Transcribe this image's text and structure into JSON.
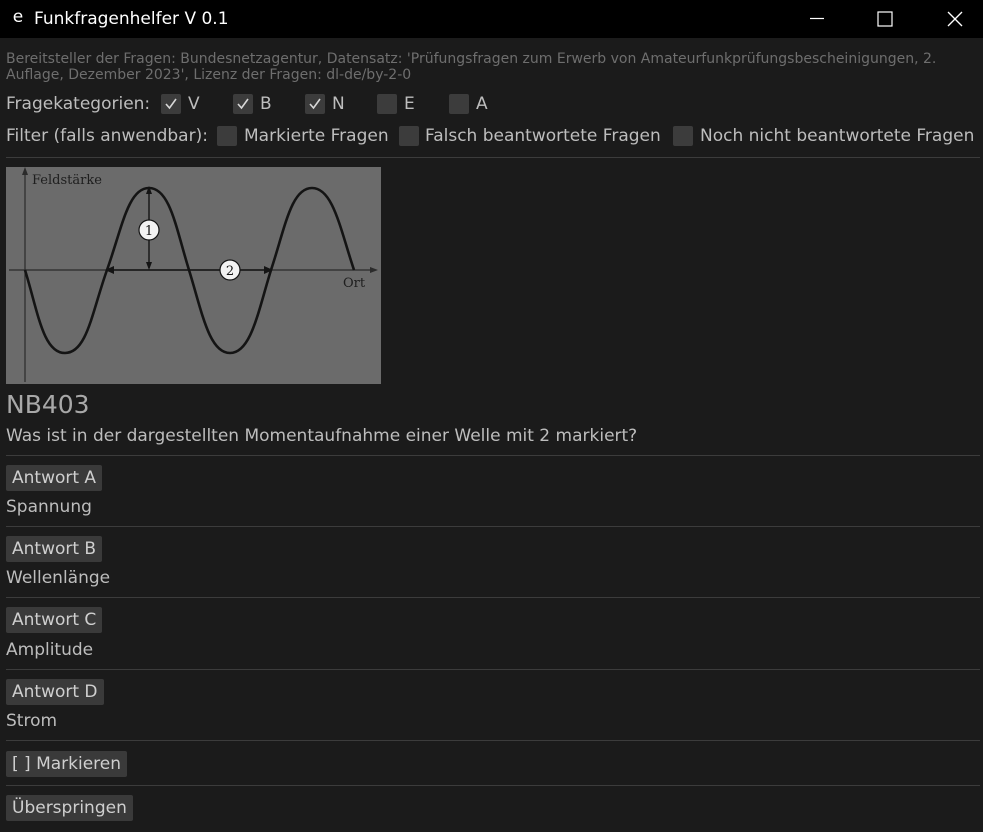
{
  "window": {
    "app_icon": "e",
    "title": "Funkfragenhelfer V 0.1",
    "controls": [
      "minimize-icon",
      "maximize-icon",
      "close-icon"
    ]
  },
  "attribution": "Bereitsteller der Fragen: Bundesnetzagentur, Datensatz: 'Prüfungsfragen zum Erwerb von Amateurfunkprüfungsbescheinigungen, 2. Auflage, Dezember 2023', Lizenz der Fragen: dl-de/by-2-0",
  "categories": {
    "label": "Fragekategorien:",
    "items": [
      {
        "label": "V",
        "checked": true
      },
      {
        "label": "B",
        "checked": true
      },
      {
        "label": "N",
        "checked": true
      },
      {
        "label": "E",
        "checked": false
      },
      {
        "label": "A",
        "checked": false
      }
    ]
  },
  "filter": {
    "label": "Filter (falls anwendbar):",
    "items": [
      {
        "label": "Markierte Fragen",
        "checked": false
      },
      {
        "label": "Falsch beantwortete Fragen",
        "checked": false
      },
      {
        "label": "Noch nicht beantwortete Fragen",
        "checked": false
      }
    ]
  },
  "figure": {
    "y_axis_label": "Feldstärke",
    "x_axis_label": "Ort",
    "marker_1": "1",
    "marker_2": "2"
  },
  "question": {
    "id": "NB403",
    "text": "Was ist in der dargestellten Momentaufnahme einer Welle mit 2 markiert?"
  },
  "answers": [
    {
      "button": "Antwort A",
      "text": "Spannung"
    },
    {
      "button": "Antwort B",
      "text": "Wellenlänge"
    },
    {
      "button": "Antwort C",
      "text": "Amplitude"
    },
    {
      "button": "Antwort D",
      "text": "Strom"
    }
  ],
  "actions": {
    "mark": "[ ] Markieren",
    "skip": "Überspringen"
  }
}
